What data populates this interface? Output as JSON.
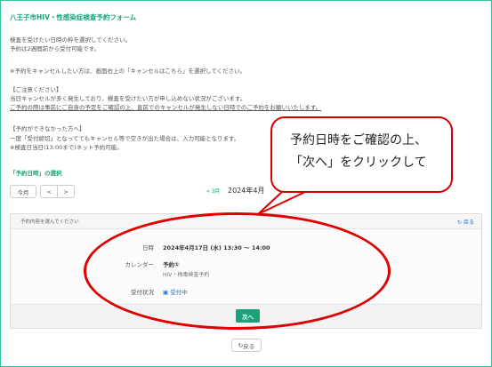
{
  "form_title": "八王子市HIV・性感染症検査予約フォーム",
  "intro_lines": [
    "検査を受けたい日時の枠を選択してください。",
    "予約は2週間前から受付可能です。",
    "※予約をキャンセルしたい方は、画面右上の「キャンセルはこちら」を選択してください。",
    "【ご注意ください】",
    "当日キャンセルが多く発生しており、検査を受けたい方が申し込めない状況がございます。",
    "ご予約の際は事前にご自身の予定をご確認の上、直前でのキャンセルが発生しない日時でのご予約をお願いいたします。",
    "【予約ができなかった方へ】",
    "一度「受付締切」となっててもキャンセル等で空きが出た場合は、入力可能となります。",
    "※検査日当日(13:00まで)ネット予約可能。"
  ],
  "section_label": "「予約日時」の選択",
  "calendar": {
    "today_label": "今月",
    "prev_label": "<",
    "next_label": ">",
    "prev_month_label": "« 3月",
    "current_month": "2024年4月"
  },
  "panel": {
    "header_title": "予約内容を選んでください",
    "back_label": "戻る",
    "rows": [
      {
        "label": "日時",
        "value": "2024年4月17日 (水) 13:30 〜 14:00"
      },
      {
        "label": "カレンダー",
        "value": "予約①",
        "sub": "HIV・梅毒検査予約"
      },
      {
        "label": "受付状況",
        "value": "受付中"
      }
    ],
    "next_button": "次へ"
  },
  "bottom_back": "戻る",
  "callout": {
    "line1": "予約日時をご確認の上、",
    "line2": "「次へ」をクリックして"
  },
  "colors": {
    "accent": "#1aa37b",
    "border": "#36c2a0",
    "annotation_red": "#e00000",
    "link": "#1a73c7"
  }
}
